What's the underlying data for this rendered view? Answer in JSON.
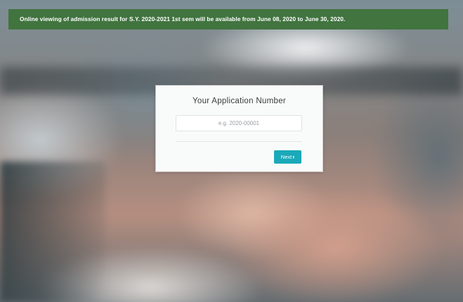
{
  "banner": {
    "text": "Online viewing of admission result for S.Y. 2020-2021 1st sem will be available from June 08, 2020 to June 30, 2020."
  },
  "form": {
    "title": "Your Application Number",
    "input_placeholder": "e.g. 2020-00001",
    "input_value": "",
    "next_label": "Next",
    "next_icon": "chevron-right-icon"
  },
  "colors": {
    "banner_bg": "#41743f",
    "button_bg": "#1aa9b9"
  }
}
